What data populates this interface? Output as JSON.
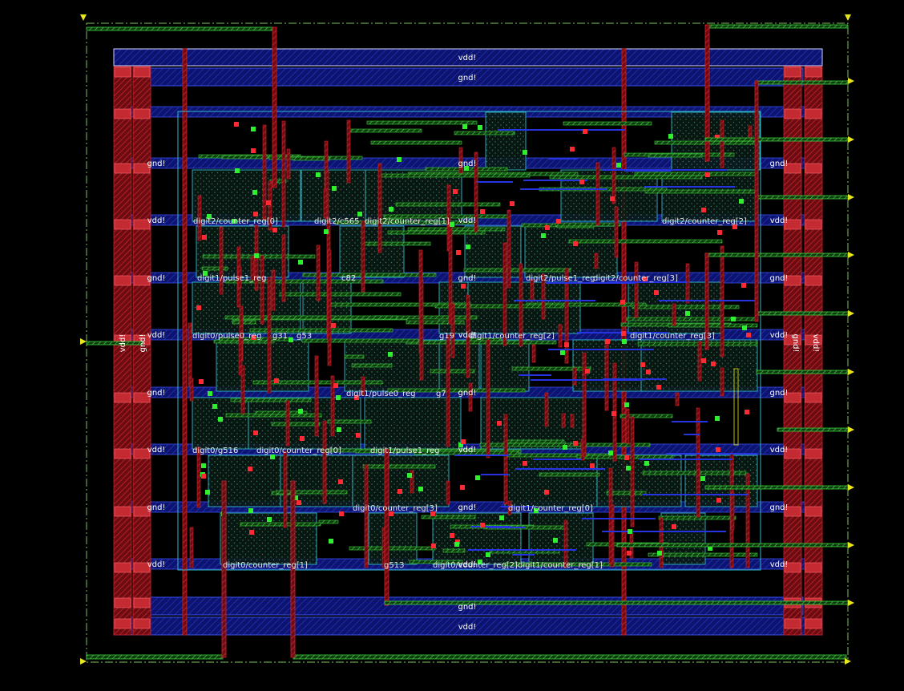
{
  "colors": {
    "background": "#000000",
    "boundary": "#7fbf5f",
    "rail_fill": "#101a8c",
    "rail_outline": "#3a4fe8",
    "ring_fill": "#b01c24",
    "metal_red": "#d02028",
    "metal_green": "#3ecf3e",
    "metal_blue": "#2633e0",
    "cell_outline": "#2fb8c8",
    "pin_yellow": "#e6e61c"
  },
  "rails": {
    "top_vdd": "vdd!",
    "top_gnd": "gnd!",
    "bottom_gnd": "gnd!",
    "bottom_vdd": "vdd!"
  },
  "ring_labels": {
    "left_vdd": "vdd!",
    "left_gnd": "gnd!",
    "right_gnd": "gnd!",
    "right_vdd": "vdd!"
  },
  "row_labels": {
    "gnd": "gnd!",
    "vdd": "vdd!"
  },
  "cells": [
    "digit2/counter_reg[0]",
    "digit2/c565",
    "digit2/counter_reg[1]",
    "digit2/counter_reg[2]",
    "digit1/pulse1_reg",
    "c82",
    "digit2/pulse1_reg",
    "digit2/counter_reg[3]",
    "digit0/pulse0_reg",
    "g31",
    "g53",
    "g19",
    "digit1/counter_reg[2]",
    "digit1/counter_reg[3]",
    "digit1/pulse0_reg",
    "g7",
    "digit0/g516",
    "digit0/counter_reg[0]",
    "digit1/pulse1_reg",
    "digit0/counter_reg[3]",
    "digit1/counter_reg[0]",
    "digit0/counter_reg[1]",
    "g513",
    "digit0/counter_reg[2]",
    "digit1/counter_reg[1]"
  ]
}
